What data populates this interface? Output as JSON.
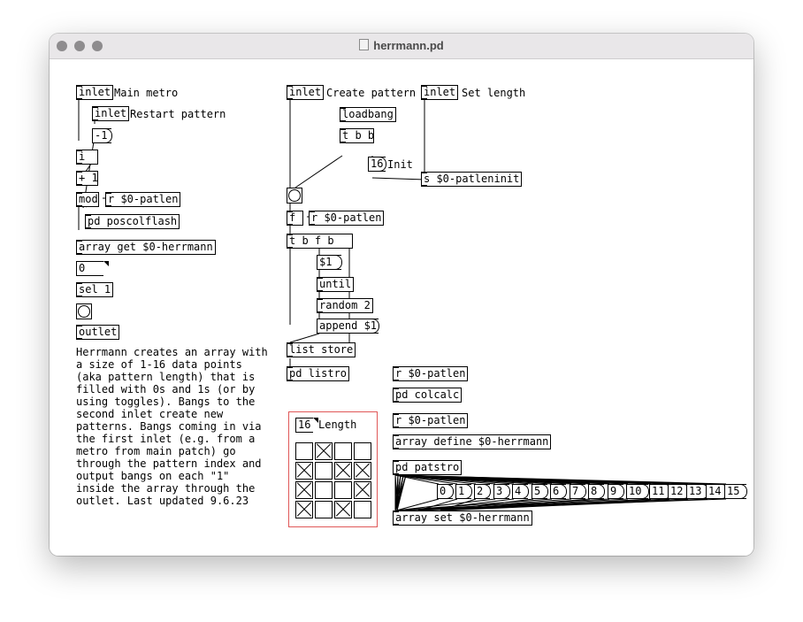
{
  "window": {
    "title": "herrmann.pd",
    "file_icon": "pd-document-icon"
  },
  "colors": {
    "gop_border": "#e05858"
  },
  "objects": {
    "inlet_main": "inlet",
    "inlet_restart": "inlet",
    "msg_minus1": "-1",
    "obj_i": "i",
    "obj_plus1": "+ 1",
    "obj_mod": "mod",
    "obj_r_patlen1": "r $0-patlen",
    "obj_pd_poscolflash": "pd poscolflash",
    "obj_array_get": "array get $0-herrmann",
    "atom_zero": "0",
    "obj_sel1": "sel 1",
    "obj_outlet": "outlet",
    "inlet_create": "inlet",
    "inlet_setlen": "inlet",
    "obj_loadbang": "loadbang",
    "obj_tbb": "t b b",
    "msg_16": "16",
    "obj_s_patleninit": "s $0-patleninit",
    "obj_f": "f",
    "obj_r_patlen2": "r $0-patlen",
    "obj_tbfb": "t b f b",
    "msg_dollar1": "$1",
    "obj_until": "until",
    "obj_random2": "random 2",
    "msg_append": "append $1",
    "obj_list_store": "list store",
    "obj_pd_listro": "pd listro",
    "obj_r_patlen3": "r $0-patlen",
    "obj_pd_colcalc": "pd colcalc",
    "obj_r_patlen4": "r $0-patlen",
    "obj_array_define": "array define $0-herrmann",
    "obj_pd_patstro": "pd patstro",
    "obj_array_set": "array set $0-herrmann",
    "gop_atom": "16"
  },
  "comments": {
    "main_metro": "Main metro",
    "restart_pattern": "Restart pattern",
    "create_pattern": "Create pattern",
    "set_length": "Set length",
    "init": "Init",
    "length": "Length",
    "description": [
      "Herrmann creates an array with",
      "a size of 1-16 data points",
      "(aka pattern length) that is",
      "filled with 0s and 1s (or by",
      "using toggles). Bangs to the",
      "second inlet create new",
      "patterns. Bangs coming in via",
      "the first inlet (e.g. from a",
      "metro from main patch) go",
      "through the pattern index and",
      "output bangs on each \"1\"",
      "inside the array through the",
      "outlet. Last updated 9.6.23"
    ]
  },
  "index_messages": [
    "0",
    "1",
    "2",
    "3",
    "4",
    "5",
    "6",
    "7",
    "8",
    "9",
    "10",
    "11",
    "12",
    "13",
    "14",
    "15"
  ],
  "toggle_grid": [
    [
      false,
      true,
      false,
      false
    ],
    [
      true,
      false,
      true,
      true
    ],
    [
      true,
      false,
      false,
      true
    ],
    [
      true,
      false,
      true,
      false
    ]
  ]
}
